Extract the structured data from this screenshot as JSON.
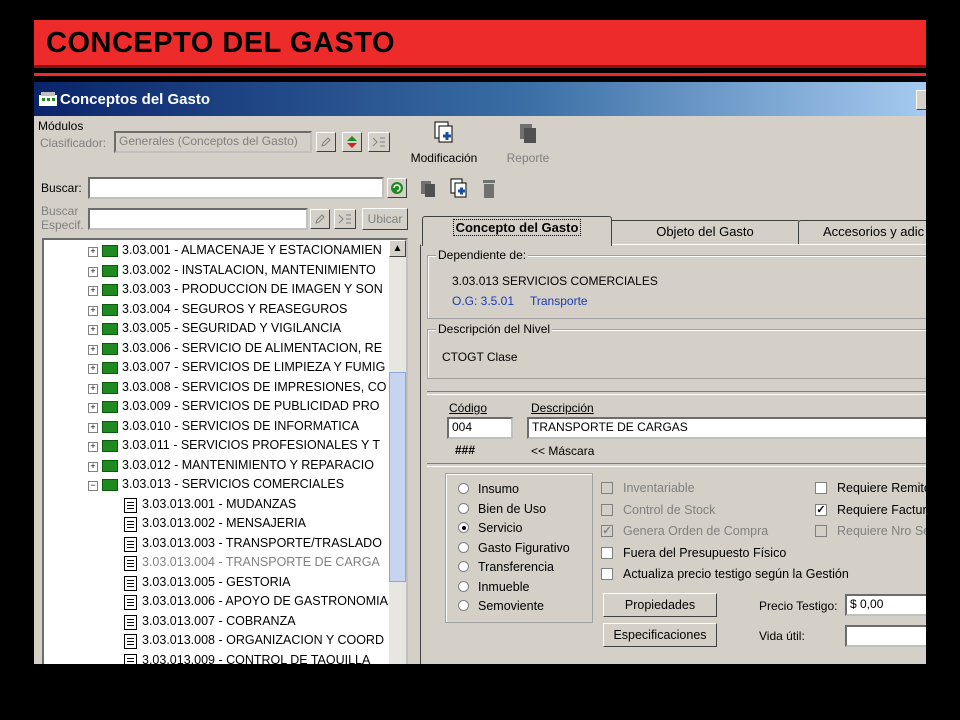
{
  "banner": {
    "title": "CONCEPTO DEL GASTO"
  },
  "window": {
    "title": "Conceptos del Gasto"
  },
  "modules": {
    "label": "Módulos",
    "clasificador_label": "Clasificador:",
    "clasificador_value": "Generales (Conceptos del Gasto)"
  },
  "toolbar": {
    "modificacion_label": "Modificación",
    "reporte_label": "Reporte"
  },
  "search": {
    "buscar_label": "Buscar:",
    "buscar_value": "",
    "buscar_especif_label_1": "Buscar",
    "buscar_especif_label_2": "Especif.",
    "ubicar_label": "Ubicar"
  },
  "tree": {
    "items": [
      {
        "label": "3.03.001 - ALMACENAJE Y ESTACIONAMIEN",
        "type": "folder"
      },
      {
        "label": "3.03.002 - INSTALACION, MANTENIMIENTO",
        "type": "folder"
      },
      {
        "label": "3.03.003 - PRODUCCION DE IMAGEN Y SON",
        "type": "folder"
      },
      {
        "label": "3.03.004 - SEGUROS Y REASEGUROS",
        "type": "folder"
      },
      {
        "label": "3.03.005 - SEGURIDAD Y VIGILANCIA",
        "type": "folder"
      },
      {
        "label": "3.03.006 - SERVICIO DE ALIMENTACION, RE",
        "type": "folder"
      },
      {
        "label": "3.03.007 - SERVICIOS DE LIMPIEZA Y FUMIG",
        "type": "folder"
      },
      {
        "label": "3.03.008 - SERVICIOS DE IMPRESIONES, CO",
        "type": "folder"
      },
      {
        "label": "3.03.009 - SERVICIOS DE PUBLICIDAD PRO",
        "type": "folder"
      },
      {
        "label": "3.03.010 - SERVICIOS DE INFORMATICA",
        "type": "folder"
      },
      {
        "label": "3.03.011 - SERVICIOS PROFESIONALES Y T",
        "type": "folder"
      },
      {
        "label": "3.03.012 - MANTENIMIENTO  Y REPARACIO",
        "type": "folder"
      },
      {
        "label": "3.03.013 - SERVICIOS COMERCIALES",
        "type": "folder-open"
      },
      {
        "label": "3.03.013.001 - MUDANZAS",
        "type": "leaf"
      },
      {
        "label": "3.03.013.002 - MENSAJERIA",
        "type": "leaf"
      },
      {
        "label": "3.03.013.003 - TRANSPORTE/TRASLADO",
        "type": "leaf"
      },
      {
        "label": "3.03.013.004 - TRANSPORTE DE CARGA",
        "type": "leaf-selected"
      },
      {
        "label": "3.03.013.005 - GESTORIA",
        "type": "leaf"
      },
      {
        "label": "3.03.013.006 - APOYO DE GASTRONOMIA",
        "type": "leaf"
      },
      {
        "label": "3.03.013.007 - COBRANZA",
        "type": "leaf"
      },
      {
        "label": "3.03.013.008 - ORGANIZACION Y COORD",
        "type": "leaf"
      },
      {
        "label": "3.03.013.009 - CONTROL DE TAQUILLA",
        "type": "leaf"
      }
    ]
  },
  "tabs": [
    {
      "label": "Concepto del Gasto"
    },
    {
      "label": "Objeto del Gasto"
    },
    {
      "label": "Accesorios y adic"
    }
  ],
  "dependiente": {
    "label": "Dependiente de:",
    "line1": "3.03.013 SERVICIOS COMERCIALES",
    "og_label": "O.G: 3.5.01",
    "og_value": "Transporte"
  },
  "descripcion_nivel": {
    "label": "Descripción del Nivel",
    "value": "CTOGT Clase"
  },
  "codigo": {
    "label": "Código",
    "value": "004"
  },
  "descripcion": {
    "label": "Descripción",
    "value": "TRANSPORTE DE CARGAS"
  },
  "mascara": {
    "value": "###",
    "label": "<< Máscara"
  },
  "types": {
    "options": [
      {
        "label": "Insumo",
        "selected": false
      },
      {
        "label": "Bien de Uso",
        "selected": false
      },
      {
        "label": "Servicio",
        "selected": true
      },
      {
        "label": "Gasto Figurativo",
        "selected": false
      },
      {
        "label": "Transferencia",
        "selected": false
      },
      {
        "label": "Inmueble",
        "selected": false
      },
      {
        "label": "Semoviente",
        "selected": false
      }
    ]
  },
  "checks_left": [
    {
      "label": "Inventariable",
      "checked": false,
      "disabled": true
    },
    {
      "label": "Control de Stock",
      "checked": false,
      "disabled": true
    },
    {
      "label": "Genera Orden de Compra",
      "checked": true,
      "disabled": true
    },
    {
      "label": "Fuera del Presupuesto Físico",
      "checked": false,
      "disabled": false
    },
    {
      "label": "Actualiza precio testigo según la Gestión",
      "checked": false,
      "disabled": false
    }
  ],
  "checks_right": [
    {
      "label": "Requiere Remito",
      "checked": false,
      "disabled": false
    },
    {
      "label": "Requiere Factura",
      "checked": true,
      "disabled": false
    },
    {
      "label": "Requiere Nro Se",
      "checked": false,
      "disabled": true
    }
  ],
  "buttons": {
    "propiedades": "Propiedades",
    "especificaciones": "Especificaciones"
  },
  "precio_testigo": {
    "label": "Precio Testigo:",
    "value": "$ 0,00"
  },
  "vida_util": {
    "label": "Vida útil:",
    "value": ""
  }
}
